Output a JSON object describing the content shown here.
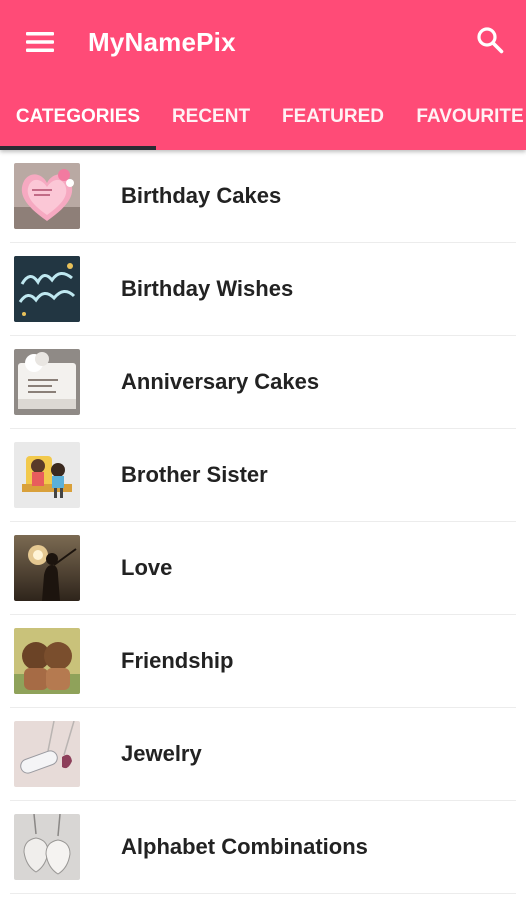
{
  "app": {
    "title": "MyNamePix",
    "accent_color": "#ff4b77",
    "menu_icon": "hamburger-menu-icon",
    "search_icon": "search-icon"
  },
  "tabs": [
    {
      "label": "CATEGORIES",
      "selected": true
    },
    {
      "label": "RECENT",
      "selected": false
    },
    {
      "label": "FEATURED",
      "selected": false
    },
    {
      "label": "FAVOURITE",
      "selected": false
    }
  ],
  "categories": [
    {
      "label": "Birthday Cakes",
      "thumbnail": "pink-heart-cake-thumbnail"
    },
    {
      "label": "Birthday Wishes",
      "thumbnail": "happy-birthday-chalkboard-thumbnail"
    },
    {
      "label": "Anniversary Cakes",
      "thumbnail": "white-anniversary-cake-thumbnail"
    },
    {
      "label": "Brother Sister",
      "thumbnail": "siblings-illustration-thumbnail"
    },
    {
      "label": "Love",
      "thumbnail": "sunset-silhouette-thumbnail"
    },
    {
      "label": "Friendship",
      "thumbnail": "two-friends-illustration-thumbnail"
    },
    {
      "label": "Jewelry",
      "thumbnail": "name-pendant-thumbnail"
    },
    {
      "label": "Alphabet Combinations",
      "thumbnail": "letter-charms-thumbnail"
    }
  ]
}
